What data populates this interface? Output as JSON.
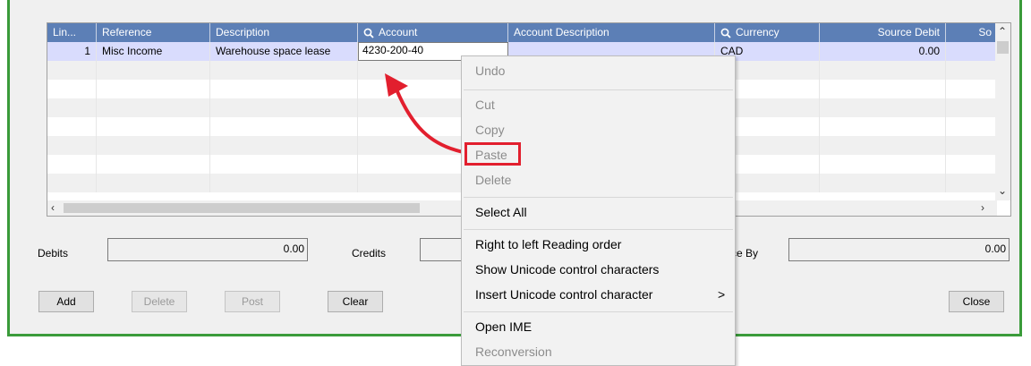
{
  "grid": {
    "columns": [
      {
        "label": "Lin...",
        "icon": ""
      },
      {
        "label": "Reference",
        "icon": ""
      },
      {
        "label": "Description",
        "icon": ""
      },
      {
        "label": "Account",
        "icon": "search-icon"
      },
      {
        "label": "Account Description",
        "icon": ""
      },
      {
        "label": "Currency",
        "icon": "search-icon"
      },
      {
        "label": "Source Debit",
        "icon": ""
      },
      {
        "label": "So",
        "icon": ""
      }
    ],
    "row1": {
      "line": "1",
      "reference": "Misc Income",
      "description": "Warehouse space lease",
      "account": "4230-200-40",
      "currency": "CAD",
      "source_debit": "0.00"
    }
  },
  "totals": {
    "debits_label": "Debits",
    "debits_value": "0.00",
    "credits_label": "Credits",
    "balance_label": "ce By",
    "balance_value": "0.00"
  },
  "buttons": {
    "add": "Add",
    "delete": "Delete",
    "post": "Post",
    "clear": "Clear",
    "close": "Close"
  },
  "context_menu": {
    "undo": "Undo",
    "cut": "Cut",
    "copy": "Copy",
    "paste": "Paste",
    "delete": "Delete",
    "select_all": "Select All",
    "rtl": "Right to left Reading order",
    "show_unicode": "Show Unicode control characters",
    "insert_unicode": "Insert Unicode control character",
    "submenu_arrow": ">",
    "open_ime": "Open IME",
    "reconversion": "Reconversion"
  },
  "colors": {
    "header_bg": "#5c7fb6",
    "selected_row": "#d9dcfd",
    "frame_green": "#3a9b3a",
    "annotation_red": "#e21f2e"
  }
}
